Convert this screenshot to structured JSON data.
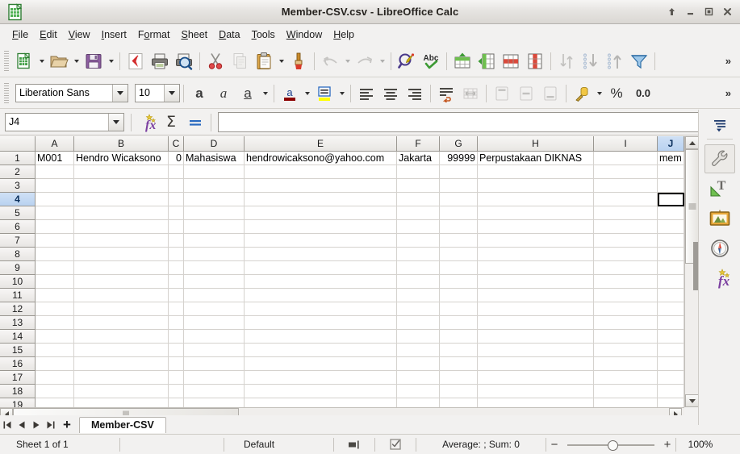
{
  "window": {
    "title": "Member-CSV.csv - LibreOffice Calc",
    "app_icon": "calc-document-icon",
    "buttons": [
      {
        "name": "shade-window-button",
        "label": "Roll Up"
      },
      {
        "name": "minimize-button",
        "label": "Minimize"
      },
      {
        "name": "maximize-button",
        "label": "Maximize"
      },
      {
        "name": "close-button",
        "label": "Close"
      }
    ]
  },
  "menubar": {
    "items": [
      {
        "label": "File",
        "accel": "F"
      },
      {
        "label": "Edit",
        "accel": "E"
      },
      {
        "label": "View",
        "accel": "V"
      },
      {
        "label": "Insert",
        "accel": "I"
      },
      {
        "label": "Format",
        "accel": "o"
      },
      {
        "label": "Sheet",
        "accel": "S"
      },
      {
        "label": "Data",
        "accel": "D"
      },
      {
        "label": "Tools",
        "accel": "T"
      },
      {
        "label": "Window",
        "accel": "W"
      },
      {
        "label": "Help",
        "accel": "H"
      }
    ]
  },
  "toolbar_standard": {
    "overflow_label": "»",
    "items": [
      {
        "name": "new-document-button",
        "icon": "new-spreadsheet-icon",
        "label": "New",
        "dropdown": true,
        "disabled": false
      },
      {
        "name": "open-document-button",
        "icon": "open-folder-icon",
        "label": "Open",
        "dropdown": true,
        "disabled": false
      },
      {
        "name": "save-document-button",
        "icon": "save-floppy-icon",
        "label": "Save",
        "dropdown": true,
        "disabled": false
      },
      {
        "name": "export-pdf-button",
        "icon": "export-pdf-icon",
        "label": "Export as PDF",
        "dropdown": false,
        "disabled": false
      },
      {
        "name": "print-button",
        "icon": "printer-icon",
        "label": "Print",
        "dropdown": false,
        "disabled": false
      },
      {
        "name": "print-preview-button",
        "icon": "print-preview-icon",
        "label": "Toggle Print Preview",
        "dropdown": false,
        "disabled": false
      },
      {
        "name": "cut-button",
        "icon": "scissors-icon",
        "label": "Cut",
        "dropdown": false,
        "disabled": false
      },
      {
        "name": "copy-button",
        "icon": "copy-icon",
        "label": "Copy",
        "dropdown": false,
        "disabled": true
      },
      {
        "name": "paste-button",
        "icon": "clipboard-icon",
        "label": "Paste",
        "dropdown": true,
        "disabled": false
      },
      {
        "name": "clone-formatting-button",
        "icon": "paintbrush-icon",
        "label": "Clone Formatting",
        "dropdown": false,
        "disabled": false
      },
      {
        "name": "undo-button",
        "icon": "undo-arrow-icon",
        "label": "Undo",
        "dropdown": true,
        "disabled": true
      },
      {
        "name": "redo-button",
        "icon": "redo-arrow-icon",
        "label": "Redo",
        "dropdown": true,
        "disabled": true
      },
      {
        "name": "find-replace-button",
        "icon": "magnifier-pencil-icon",
        "label": "Find and Replace",
        "dropdown": false,
        "disabled": false
      },
      {
        "name": "spelling-button",
        "icon": "abc-check-icon",
        "label": "Spelling",
        "dropdown": false,
        "disabled": false
      },
      {
        "name": "row-insert-button",
        "icon": "insert-row-icon",
        "label": "Insert Row",
        "dropdown": false,
        "disabled": false
      },
      {
        "name": "column-insert-button",
        "icon": "insert-column-icon",
        "label": "Insert Column",
        "dropdown": false,
        "disabled": false
      },
      {
        "name": "delete-row-button",
        "icon": "delete-row-icon",
        "label": "Delete Row",
        "dropdown": false,
        "disabled": false
      },
      {
        "name": "delete-column-button",
        "icon": "delete-column-icon",
        "label": "Delete Column",
        "dropdown": false,
        "disabled": false
      },
      {
        "name": "sort-button",
        "icon": "sort-icon",
        "label": "Sort",
        "dropdown": false,
        "disabled": true
      },
      {
        "name": "sort-ascending-button",
        "icon": "sort-ascending-icon",
        "label": "Sort Ascending",
        "dropdown": false,
        "disabled": true
      },
      {
        "name": "sort-descending-button",
        "icon": "sort-descending-icon",
        "label": "Sort Descending",
        "dropdown": false,
        "disabled": true
      },
      {
        "name": "autofilter-button",
        "icon": "funnel-icon",
        "label": "AutoFilter",
        "dropdown": false,
        "disabled": false
      }
    ]
  },
  "toolbar_formatting": {
    "font_name": "Liberation Sans",
    "font_size": "10",
    "percent_label": "%",
    "decimal_label": "0.0",
    "overflow_label": "»",
    "items": [
      {
        "name": "bold-button",
        "icon": "bold-a-icon",
        "label": "Bold"
      },
      {
        "name": "italic-button",
        "icon": "italic-a-icon",
        "label": "Italic"
      },
      {
        "name": "underline-button",
        "icon": "underline-a-icon",
        "label": "Underline"
      },
      {
        "name": "font-color-button",
        "icon": "font-color-icon",
        "label": "Font Color"
      },
      {
        "name": "highlight-color-button",
        "icon": "highlight-color-icon",
        "label": "Highlighting Color"
      },
      {
        "name": "align-left-button",
        "icon": "align-left-icon",
        "label": "Align Left"
      },
      {
        "name": "align-center-button",
        "icon": "align-center-icon",
        "label": "Align Center"
      },
      {
        "name": "align-right-button",
        "icon": "align-right-icon",
        "label": "Align Right"
      },
      {
        "name": "wrap-text-button",
        "icon": "wrap-text-icon",
        "label": "Wrap Text"
      },
      {
        "name": "merge-cells-button",
        "icon": "merge-cells-icon",
        "label": "Merge Cells"
      },
      {
        "name": "align-top-button",
        "icon": "align-top-icon",
        "label": "Align Top"
      },
      {
        "name": "align-center-vertically-button",
        "icon": "align-middle-icon",
        "label": "Center Vertically"
      },
      {
        "name": "align-bottom-button",
        "icon": "align-bottom-icon",
        "label": "Align Bottom"
      },
      {
        "name": "currency-format-button",
        "icon": "currency-coins-icon",
        "label": "Format as Currency"
      }
    ]
  },
  "formula_bar": {
    "name_box_value": "J4",
    "input_line_value": "",
    "function_wizard_label": "Function Wizard",
    "sum_label": "Select Function",
    "formula_label": "Formula"
  },
  "sheet": {
    "columns": [
      {
        "label": "A",
        "width": 48,
        "selected": false
      },
      {
        "label": "B",
        "width": 117,
        "selected": false
      },
      {
        "label": "C",
        "width": 19,
        "selected": false
      },
      {
        "label": "D",
        "width": 75,
        "selected": false
      },
      {
        "label": "E",
        "width": 189,
        "selected": false
      },
      {
        "label": "F",
        "width": 53,
        "selected": false
      },
      {
        "label": "G",
        "width": 47,
        "selected": false
      },
      {
        "label": "H",
        "width": 144,
        "selected": false
      },
      {
        "label": "I",
        "width": 79,
        "selected": false
      },
      {
        "label": "J",
        "width": 33,
        "selected": true
      }
    ],
    "rows": [
      {
        "label": "1",
        "selected": false
      },
      {
        "label": "2",
        "selected": false
      },
      {
        "label": "3",
        "selected": false
      },
      {
        "label": "4",
        "selected": true
      },
      {
        "label": "5",
        "selected": false
      },
      {
        "label": "6",
        "selected": false
      },
      {
        "label": "7",
        "selected": false
      },
      {
        "label": "8",
        "selected": false
      },
      {
        "label": "9",
        "selected": false
      },
      {
        "label": "10",
        "selected": false
      },
      {
        "label": "11",
        "selected": false
      },
      {
        "label": "12",
        "selected": false
      },
      {
        "label": "13",
        "selected": false
      },
      {
        "label": "14",
        "selected": false
      },
      {
        "label": "15",
        "selected": false
      },
      {
        "label": "16",
        "selected": false
      },
      {
        "label": "17",
        "selected": false
      },
      {
        "label": "18",
        "selected": false
      },
      {
        "label": "19",
        "selected": false
      }
    ],
    "data": [
      [
        {
          "v": "M001",
          "align": "left"
        },
        {
          "v": "Hendro Wicaksono",
          "align": "left"
        },
        {
          "v": "0",
          "align": "right"
        },
        {
          "v": "Mahasiswa",
          "align": "left"
        },
        {
          "v": "hendrowicaksono@yahoo.com",
          "align": "left"
        },
        {
          "v": "Jakarta",
          "align": "left"
        },
        {
          "v": "99999",
          "align": "right"
        },
        {
          "v": "Perpustakaan DIKNAS",
          "align": "left"
        },
        {
          "v": "",
          "align": "left"
        },
        {
          "v": "mem",
          "align": "left"
        }
      ]
    ],
    "cursor": {
      "column": "J",
      "row": "4"
    }
  },
  "sidebar": {
    "items": [
      {
        "name": "sidebar-settings-button",
        "icon": "sidebar-settings-icon",
        "label": "Sidebar Settings",
        "active": false
      },
      {
        "name": "sidebar-item-properties",
        "icon": "wrench-icon",
        "label": "Properties",
        "active": true
      },
      {
        "name": "sidebar-item-styles",
        "icon": "styles-t-icon",
        "label": "Styles",
        "active": false
      },
      {
        "name": "sidebar-item-gallery",
        "icon": "gallery-picture-icon",
        "label": "Gallery",
        "active": false
      },
      {
        "name": "sidebar-item-navigator",
        "icon": "compass-icon",
        "label": "Navigator",
        "active": false
      },
      {
        "name": "sidebar-item-functions",
        "icon": "functions-fx-icon",
        "label": "Functions",
        "active": false
      }
    ]
  },
  "sheet_tabs": {
    "nav": [
      {
        "name": "first-sheet-button",
        "icon": "first-sheet-icon",
        "label": "First Sheet"
      },
      {
        "name": "previous-sheet-button",
        "icon": "previous-sheet-icon",
        "label": "Previous Sheet"
      },
      {
        "name": "next-sheet-button",
        "icon": "next-sheet-icon",
        "label": "Next Sheet"
      },
      {
        "name": "last-sheet-button",
        "icon": "last-sheet-icon",
        "label": "Last Sheet"
      }
    ],
    "add_label": "+",
    "tabs": [
      {
        "label": "Member-CSV",
        "active": true
      }
    ]
  },
  "statusbar": {
    "sheet_count": "Sheet 1 of 1",
    "page_style": "Default",
    "selection_mode_icon": "selection-mode-icon",
    "modified_icon": "document-modified-icon",
    "summary": "Average: ; Sum: 0",
    "zoom_minus": "−",
    "zoom_plus": "+",
    "zoom_level": "100%"
  },
  "colors": {
    "titlebar_text": "#25221e",
    "selection_header": "#b9d2f0",
    "window_bg": "#f2f1f0",
    "grid_line": "#d5d2ce",
    "header_line": "#9a9791",
    "cursor_border": "#000000"
  }
}
